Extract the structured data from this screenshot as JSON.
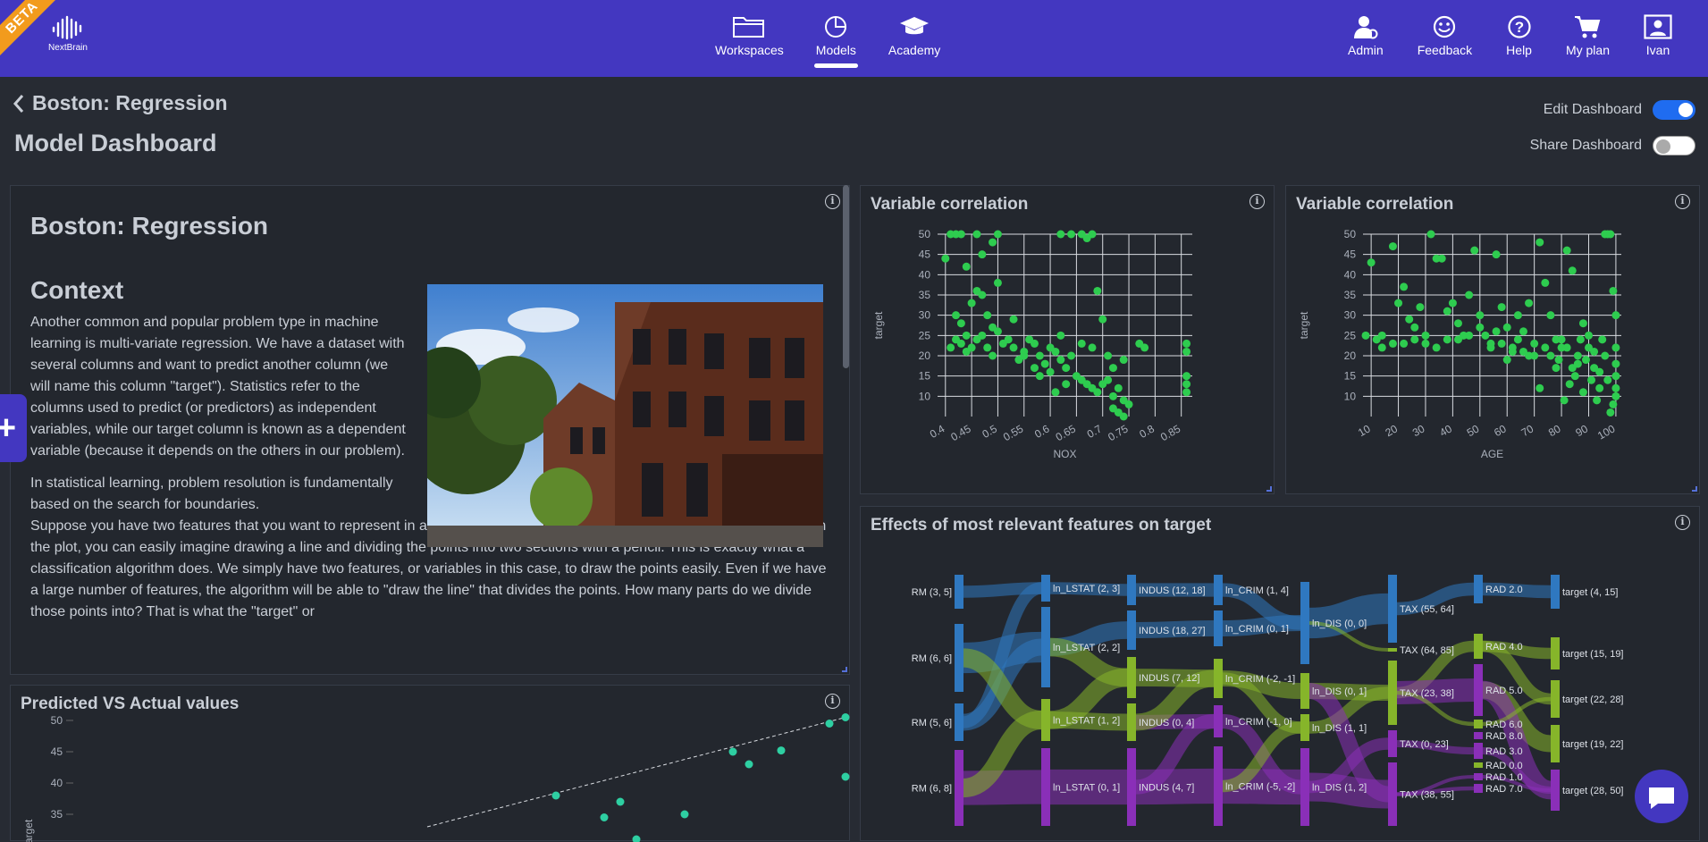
{
  "nav": {
    "beta": "BETA",
    "logo_text": "NextBrain",
    "center": [
      {
        "label": "Workspaces",
        "icon": "folder-icon"
      },
      {
        "label": "Models",
        "icon": "chart-icon",
        "active": true
      },
      {
        "label": "Academy",
        "icon": "graduation-cap-icon"
      }
    ],
    "right": [
      {
        "label": "Admin",
        "icon": "admin-icon"
      },
      {
        "label": "Feedback",
        "icon": "smile-icon"
      },
      {
        "label": "Help",
        "icon": "help-icon"
      },
      {
        "label": "My plan",
        "icon": "cart-icon"
      },
      {
        "label": "Ivan",
        "icon": "user-icon"
      }
    ]
  },
  "header": {
    "back_label": "Boston: Regression",
    "title": "Model Dashboard",
    "edit_dashboard": {
      "label": "Edit Dashboard",
      "on": true
    },
    "share_dashboard": {
      "label": "Share Dashboard",
      "on": false
    }
  },
  "article": {
    "title": "Boston: Regression",
    "section": "Context",
    "p1": "Another common and popular problem type in machine learning is multi-variate regression. We have a dataset with several columns and want to predict another column (we will name this column \"target\"). Statistics refer to the columns used to predict (or predictors) as independent variables, while our target column is known as a dependent variable (because it depends on the others in our problem).",
    "p2a": "In statistical learning, problem resolution is fundamentally based on the search for boundaries.",
    "p2b": "Suppose you have two features that you want to represent in a two-dimensional plot. Once you have all of the points shown in the plot, you can easily imagine drawing a line and dividing the points into two sections with a pencil. This is exactly what a classification algorithm does. We simply have two features, or variables in this case, to draw the points easily. Even if we have a large number of features, the algorithm will be able to \"draw the line\" that divides the points. How many parts do we divide those points into? That is what the \"target\" or"
  },
  "panels": {
    "corr1_title": "Variable correlation",
    "corr2_title": "Variable correlation",
    "effects_title": "Effects of most relevant features on target",
    "pred_title": "Predicted VS Actual values",
    "info": "i"
  },
  "chart_data": [
    {
      "type": "scatter",
      "title": "Variable correlation",
      "xlabel": "NOX",
      "ylabel": "target",
      "xlim": [
        0.385,
        0.871
      ],
      "ylim": [
        5,
        50
      ],
      "xticks": [
        "0.4",
        "0.45",
        "0.5",
        "0.55",
        "0.6",
        "0.65",
        "0.7",
        "0.75",
        "0.8",
        "0.85"
      ],
      "yticks": [
        "50",
        "45",
        "40",
        "35",
        "30",
        "25",
        "20",
        "15",
        "10"
      ],
      "color": "#2ecc4f",
      "points": [
        [
          0.4,
          44
        ],
        [
          0.41,
          50
        ],
        [
          0.42,
          50
        ],
        [
          0.43,
          50
        ],
        [
          0.44,
          42
        ],
        [
          0.46,
          50
        ],
        [
          0.47,
          45
        ],
        [
          0.49,
          48
        ],
        [
          0.5,
          50
        ],
        [
          0.42,
          30
        ],
        [
          0.43,
          28
        ],
        [
          0.44,
          25
        ],
        [
          0.45,
          33
        ],
        [
          0.46,
          36
        ],
        [
          0.47,
          35
        ],
        [
          0.48,
          30
        ],
        [
          0.49,
          27
        ],
        [
          0.5,
          38
        ],
        [
          0.41,
          22
        ],
        [
          0.42,
          24
        ],
        [
          0.43,
          23
        ],
        [
          0.44,
          21
        ],
        [
          0.45,
          22
        ],
        [
          0.46,
          24
        ],
        [
          0.47,
          25
        ],
        [
          0.48,
          22
        ],
        [
          0.49,
          20
        ],
        [
          0.5,
          26
        ],
        [
          0.51,
          23
        ],
        [
          0.52,
          24
        ],
        [
          0.53,
          22
        ],
        [
          0.54,
          19
        ],
        [
          0.55,
          21
        ],
        [
          0.56,
          24
        ],
        [
          0.57,
          23
        ],
        [
          0.58,
          20
        ],
        [
          0.59,
          18
        ],
        [
          0.6,
          22
        ],
        [
          0.61,
          21
        ],
        [
          0.62,
          19
        ],
        [
          0.63,
          17
        ],
        [
          0.64,
          20
        ],
        [
          0.65,
          15
        ],
        [
          0.66,
          14
        ],
        [
          0.67,
          13
        ],
        [
          0.68,
          12
        ],
        [
          0.69,
          11
        ],
        [
          0.7,
          13
        ],
        [
          0.71,
          14
        ],
        [
          0.72,
          10
        ],
        [
          0.73,
          12
        ],
        [
          0.74,
          9
        ],
        [
          0.75,
          8
        ],
        [
          0.62,
          50
        ],
        [
          0.64,
          50
        ],
        [
          0.66,
          50
        ],
        [
          0.67,
          49
        ],
        [
          0.68,
          50
        ],
        [
          0.69,
          36
        ],
        [
          0.7,
          29
        ],
        [
          0.58,
          15
        ],
        [
          0.6,
          16
        ],
        [
          0.62,
          25
        ],
        [
          0.53,
          29
        ],
        [
          0.55,
          20
        ],
        [
          0.57,
          17
        ],
        [
          0.61,
          11
        ],
        [
          0.63,
          13
        ],
        [
          0.66,
          23
        ],
        [
          0.68,
          22
        ],
        [
          0.71,
          20
        ],
        [
          0.72,
          17
        ],
        [
          0.74,
          19
        ],
        [
          0.77,
          23
        ],
        [
          0.78,
          22
        ],
        [
          0.86,
          23
        ],
        [
          0.86,
          21
        ],
        [
          0.86,
          15
        ],
        [
          0.86,
          13
        ],
        [
          0.86,
          11
        ],
        [
          0.72,
          7
        ],
        [
          0.73,
          6
        ],
        [
          0.74,
          5
        ]
      ]
    },
    {
      "type": "scatter",
      "title": "Variable correlation",
      "xlabel": "AGE",
      "ylabel": "target",
      "xlim": [
        7,
        102
      ],
      "ylim": [
        5,
        50
      ],
      "xticks": [
        "10",
        "20",
        "30",
        "40",
        "50",
        "60",
        "70",
        "80",
        "90",
        "100"
      ],
      "yticks": [
        "50",
        "45",
        "40",
        "35",
        "30",
        "25",
        "20",
        "15",
        "10"
      ],
      "color": "#2ecc4f",
      "points": [
        [
          8,
          25
        ],
        [
          10,
          43
        ],
        [
          12,
          24
        ],
        [
          14,
          22
        ],
        [
          18,
          47
        ],
        [
          20,
          33
        ],
        [
          22,
          37
        ],
        [
          24,
          29
        ],
        [
          26,
          27
        ],
        [
          28,
          32
        ],
        [
          30,
          25
        ],
        [
          32,
          50
        ],
        [
          34,
          44
        ],
        [
          36,
          44
        ],
        [
          38,
          31
        ],
        [
          40,
          33
        ],
        [
          42,
          28
        ],
        [
          44,
          25
        ],
        [
          46,
          35
        ],
        [
          48,
          46
        ],
        [
          50,
          30
        ],
        [
          52,
          25
        ],
        [
          54,
          23
        ],
        [
          56,
          45
        ],
        [
          58,
          32
        ],
        [
          60,
          27
        ],
        [
          62,
          22
        ],
        [
          64,
          30
        ],
        [
          66,
          26
        ],
        [
          68,
          33
        ],
        [
          70,
          20
        ],
        [
          72,
          48
        ],
        [
          74,
          38
        ],
        [
          76,
          30
        ],
        [
          78,
          24
        ],
        [
          80,
          22
        ],
        [
          82,
          46
        ],
        [
          84,
          41
        ],
        [
          86,
          18
        ],
        [
          88,
          28
        ],
        [
          90,
          25
        ],
        [
          92,
          21
        ],
        [
          94,
          16
        ],
        [
          96,
          50
        ],
        [
          97,
          50
        ],
        [
          98,
          50
        ],
        [
          99,
          36
        ],
        [
          100,
          30
        ],
        [
          100,
          22
        ],
        [
          100,
          18
        ],
        [
          100,
          15
        ],
        [
          100,
          12
        ],
        [
          100,
          10
        ],
        [
          99,
          8
        ],
        [
          98,
          6
        ],
        [
          97,
          14
        ],
        [
          96,
          20
        ],
        [
          95,
          24
        ],
        [
          94,
          12
        ],
        [
          93,
          9
        ],
        [
          92,
          17
        ],
        [
          91,
          14
        ],
        [
          90,
          22
        ],
        [
          89,
          19
        ],
        [
          88,
          11
        ],
        [
          87,
          24
        ],
        [
          86,
          20
        ],
        [
          85,
          15
        ],
        [
          84,
          17
        ],
        [
          83,
          13
        ],
        [
          82,
          22
        ],
        [
          81,
          9
        ],
        [
          80,
          24
        ],
        [
          79,
          19
        ],
        [
          78,
          17
        ],
        [
          76,
          20
        ],
        [
          74,
          22
        ],
        [
          72,
          12
        ],
        [
          70,
          23
        ],
        [
          68,
          20
        ],
        [
          66,
          21
        ],
        [
          64,
          24
        ],
        [
          62,
          21
        ],
        [
          60,
          19
        ],
        [
          58,
          23
        ],
        [
          56,
          26
        ],
        [
          54,
          22
        ],
        [
          50,
          27
        ],
        [
          46,
          25
        ],
        [
          42,
          24
        ],
        [
          38,
          24
        ],
        [
          34,
          22
        ],
        [
          30,
          23
        ],
        [
          26,
          24
        ],
        [
          22,
          23
        ],
        [
          18,
          23
        ],
        [
          14,
          25
        ]
      ]
    },
    {
      "type": "scatter",
      "title": "Predicted VS Actual values",
      "ylabel": "target",
      "ylim": [
        32,
        52
      ],
      "yticks": [
        "50",
        "45",
        "40",
        "35"
      ],
      "color": "#2ecfa2",
      "points": [
        [
          30,
          38
        ],
        [
          33,
          34.5
        ],
        [
          34,
          37
        ],
        [
          35,
          31
        ],
        [
          38,
          35
        ],
        [
          41,
          45
        ],
        [
          42,
          43
        ],
        [
          44,
          45.2
        ],
        [
          47,
          49.5
        ],
        [
          48,
          50.5
        ],
        [
          48,
          41
        ]
      ],
      "trend": [
        [
          22,
          33
        ],
        [
          48,
          50.5
        ]
      ]
    }
  ],
  "sankey": {
    "columns": [
      [
        "RM (3, 5]",
        "RM (6, 6]",
        "RM (5, 6]",
        "RM (6, 8]"
      ],
      [
        "ln_LSTAT (2, 3]",
        "ln_LSTAT (2, 2]",
        "ln_LSTAT (1, 2]",
        "ln_LSTAT (0, 1]"
      ],
      [
        "INDUS (12, 18]",
        "INDUS (18, 27]",
        "INDUS (7, 12]",
        "INDUS (0, 4]",
        "INDUS (4, 7]"
      ],
      [
        "ln_CRIM (1, 4]",
        "ln_CRIM (0, 1]",
        "ln_CRIM (-2, -1]",
        "ln_CRIM (-1, 0]",
        "ln_CRIM (-5, -2]"
      ],
      [
        "ln_DIS (0, 0]",
        "ln_DIS (0, 1]",
        "ln_DIS (1, 1]",
        "ln_DIS (1, 2]"
      ],
      [
        "TAX (55, 64]",
        "TAX (64, 85]",
        "TAX (23, 38]",
        "TAX (0, 23]",
        "TAX (38, 55]"
      ],
      [
        "RAD 2.0",
        "RAD 4.0",
        "RAD 5.0",
        "RAD 6.0",
        "RAD 8.0",
        "RAD 3.0",
        "RAD 0.0",
        "RAD 1.0",
        "RAD 7.0"
      ],
      [
        "target (4, 15]",
        "target (15, 19]",
        "target (22, 28]",
        "target (19, 22]",
        "target (28, 50]"
      ]
    ],
    "colors": {
      "blue": "#2f78c0",
      "green": "#86b52a",
      "purple": "#8a2fb8"
    }
  }
}
